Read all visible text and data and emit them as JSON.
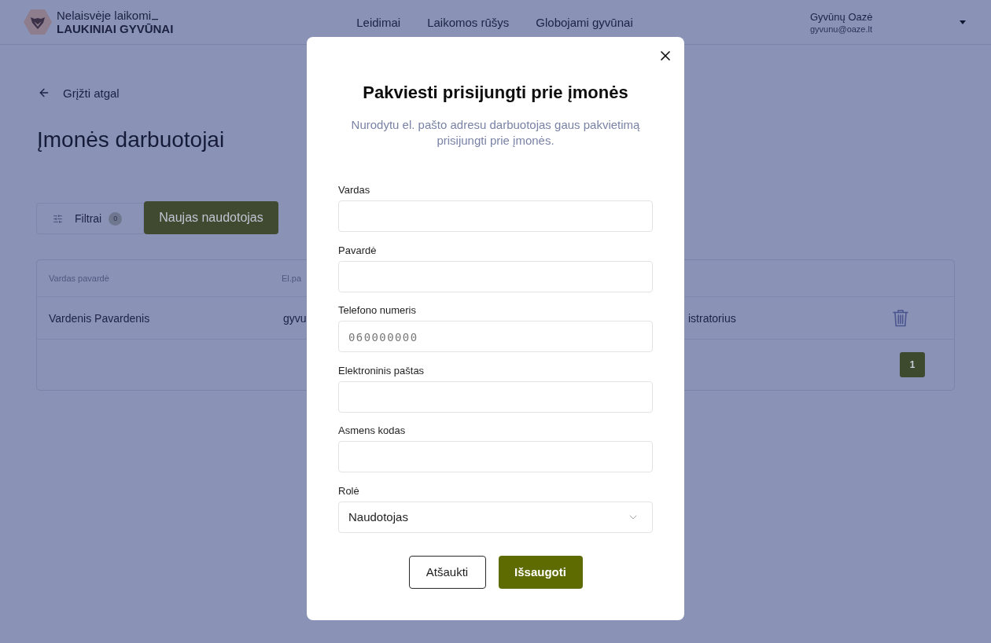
{
  "header": {
    "logo": {
      "tagline": "Nelaisvėje laikomi",
      "title": "LAUKINIAI GYVŪNAI"
    },
    "nav": [
      {
        "label": "Leidimai"
      },
      {
        "label": "Laikomos rūšys"
      },
      {
        "label": "Globojami gyvūnai"
      }
    ],
    "user": {
      "name": "Gyvūnų Oazė",
      "email": "gyvunu@oaze.lt"
    }
  },
  "page": {
    "back_link": "Grįžti atgal",
    "title": "Įmonės darbuotojai",
    "filter_button": {
      "label": "Filtrai",
      "count": "0"
    },
    "new_user_button": "Naujas naudotojas",
    "table": {
      "columns": [
        "Vardas pavardė",
        "El.pa"
      ],
      "rows": [
        {
          "cells": [
            "Vardenis Pavardenis",
            "gyvu",
            "istratorius"
          ]
        }
      ],
      "pagination": [
        {
          "label": "1",
          "selected": true
        }
      ]
    }
  },
  "modal": {
    "title": "Pakviesti prisijungti prie įmonės",
    "subtitle": "Nurodytu el. pašto adresu darbuotojas gaus pakvietimą prisijungti prie įmonės.",
    "fields": [
      {
        "kind": "text",
        "label": "Vardas"
      },
      {
        "kind": "text",
        "label": "Pavardė"
      },
      {
        "kind": "text",
        "label": "Telefono numeris",
        "placeholder": "060000000"
      },
      {
        "kind": "text",
        "label": "Elektroninis paštas"
      },
      {
        "kind": "text",
        "label": "Asmens kodas"
      },
      {
        "kind": "select",
        "label": "Rolė",
        "value": "Naudotojas"
      }
    ],
    "buttons": [
      {
        "kind": "secondary",
        "label": "Atšaukti"
      },
      {
        "kind": "primary",
        "label": "Išsaugoti"
      }
    ]
  }
}
